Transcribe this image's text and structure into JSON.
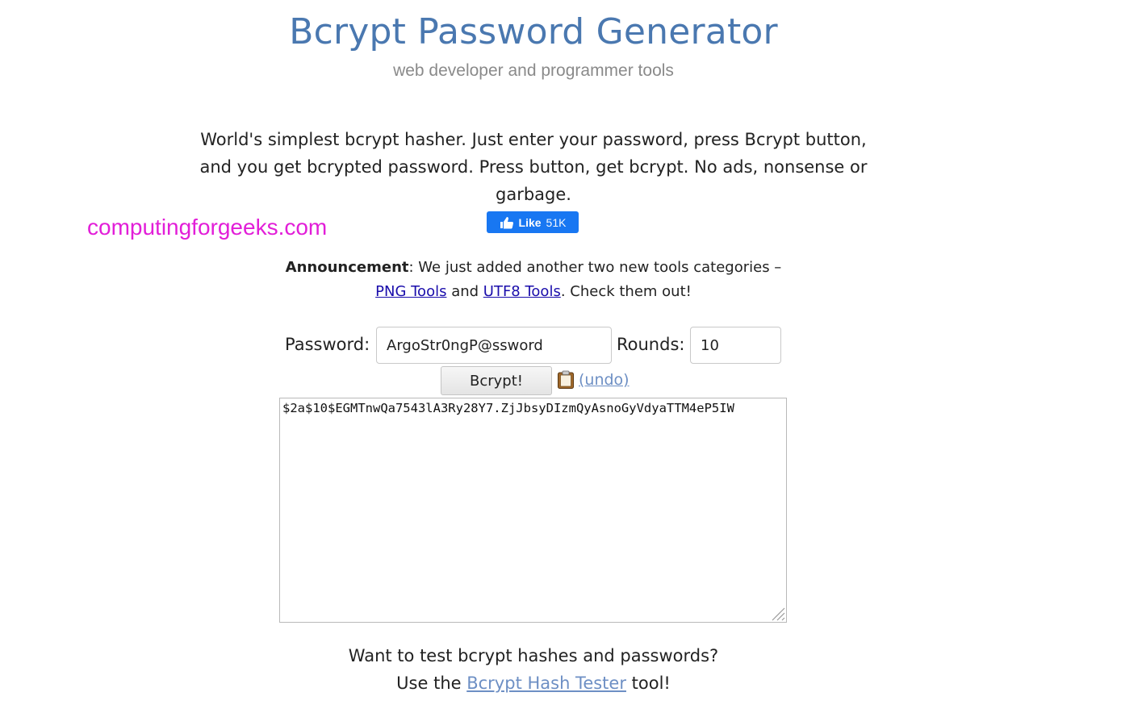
{
  "header": {
    "title": "Bcrypt Password Generator",
    "subtitle": "web developer and programmer tools"
  },
  "intro": {
    "text": "World's simplest bcrypt hasher. Just enter your password, press Bcrypt button, and you get bcrypted password. Press button, get bcrypt. No ads, nonsense or garbage."
  },
  "facebook_like": {
    "label": "Like",
    "count": "51K",
    "color": "#1877f2"
  },
  "watermark": {
    "text": "computingforgeeks.com",
    "color": "#e21ed8"
  },
  "announcement": {
    "heading": "Announcement",
    "text_before": ": We just added another two new tools categories – ",
    "link1": "PNG Tools",
    "text_middle": " and ",
    "link2": "UTF8 Tools",
    "text_after": ". Check them out!"
  },
  "form": {
    "password_label": "Password:",
    "password_value": "ArgoStr0ngP@ssword",
    "rounds_label": "Rounds:",
    "rounds_value": "10",
    "bcrypt_button": "Bcrypt!",
    "undo_link": "(undo)",
    "output_value": "$2a$10$EGMTnwQa7543lA3Ry28Y7.ZjJbsyDIzmQyAsnoGyVdyaTTM4eP5IW"
  },
  "tester": {
    "line1": "Want to test bcrypt hashes and passwords?",
    "text_before": "Use the ",
    "link": "Bcrypt Hash Tester",
    "text_after": " tool!"
  },
  "colors": {
    "title": "#4a78b0",
    "link_blue": "#1a0dab",
    "link_light": "#6d8fc4"
  }
}
